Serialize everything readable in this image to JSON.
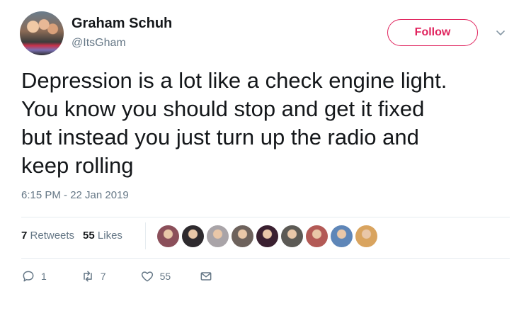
{
  "author": {
    "name": "Graham Schuh",
    "handle": "@ItsGham"
  },
  "follow_button": {
    "label": "Follow"
  },
  "tweet": {
    "line1": "Depression is a lot like a check engine light.",
    "line2": "You know you should stop and get it fixed",
    "line3": "but instead you just turn up the radio and",
    "line4": "keep rolling",
    "timestamp": "6:15 PM - 22 Jan 2019"
  },
  "stats": {
    "retweets_count": "7",
    "retweets_label": "Retweets",
    "likes_count": "55",
    "likes_label": "Likes"
  },
  "likers": [
    {
      "color": "#8b4f5a"
    },
    {
      "color": "#2e2a2e"
    },
    {
      "color": "#a9a4a8"
    },
    {
      "color": "#6d625c"
    },
    {
      "color": "#3a2030"
    },
    {
      "color": "#5c5a55"
    },
    {
      "color": "#b35a56"
    },
    {
      "color": "#5e86b8"
    },
    {
      "color": "#d9a45f"
    }
  ],
  "actions": {
    "reply_count": "1",
    "retweet_count": "7",
    "like_count": "55"
  },
  "colors": {
    "accent": "#e0245e",
    "muted": "#657786",
    "text": "#14171a"
  }
}
